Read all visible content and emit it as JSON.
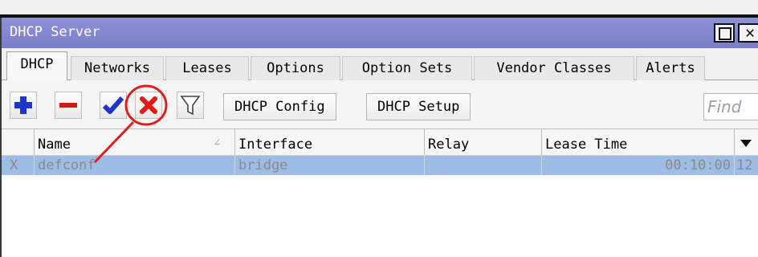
{
  "window": {
    "title": "DHCP Server"
  },
  "tabs": [
    {
      "label": "DHCP",
      "active": true
    },
    {
      "label": "Networks"
    },
    {
      "label": "Leases"
    },
    {
      "label": "Options"
    },
    {
      "label": "Option Sets"
    },
    {
      "label": "Vendor Classes"
    },
    {
      "label": "Alerts"
    }
  ],
  "toolbar": {
    "add_icon": "plus-icon",
    "remove_icon": "minus-icon",
    "enable_icon": "check-icon",
    "disable_icon": "x-icon",
    "filter_icon": "filter-icon",
    "dhcp_config_label": "DHCP Config",
    "dhcp_setup_label": "DHCP Setup",
    "find_placeholder": "Find"
  },
  "table": {
    "columns": [
      "Name",
      "Interface",
      "Relay",
      "Lease Time"
    ],
    "rows": [
      {
        "flag": "X",
        "name": "defconf",
        "interface": "bridge",
        "relay": "",
        "lease_time": "00:10:00",
        "extra": "12"
      }
    ]
  },
  "colors": {
    "titlebar": "#7f82cd",
    "selected_row": "#9dbde6",
    "annotation": "#e01e1e",
    "add_icon": "#1f35c9",
    "remove_icon": "#d41919",
    "check_icon": "#1f35c9",
    "x_icon": "#e01919"
  }
}
